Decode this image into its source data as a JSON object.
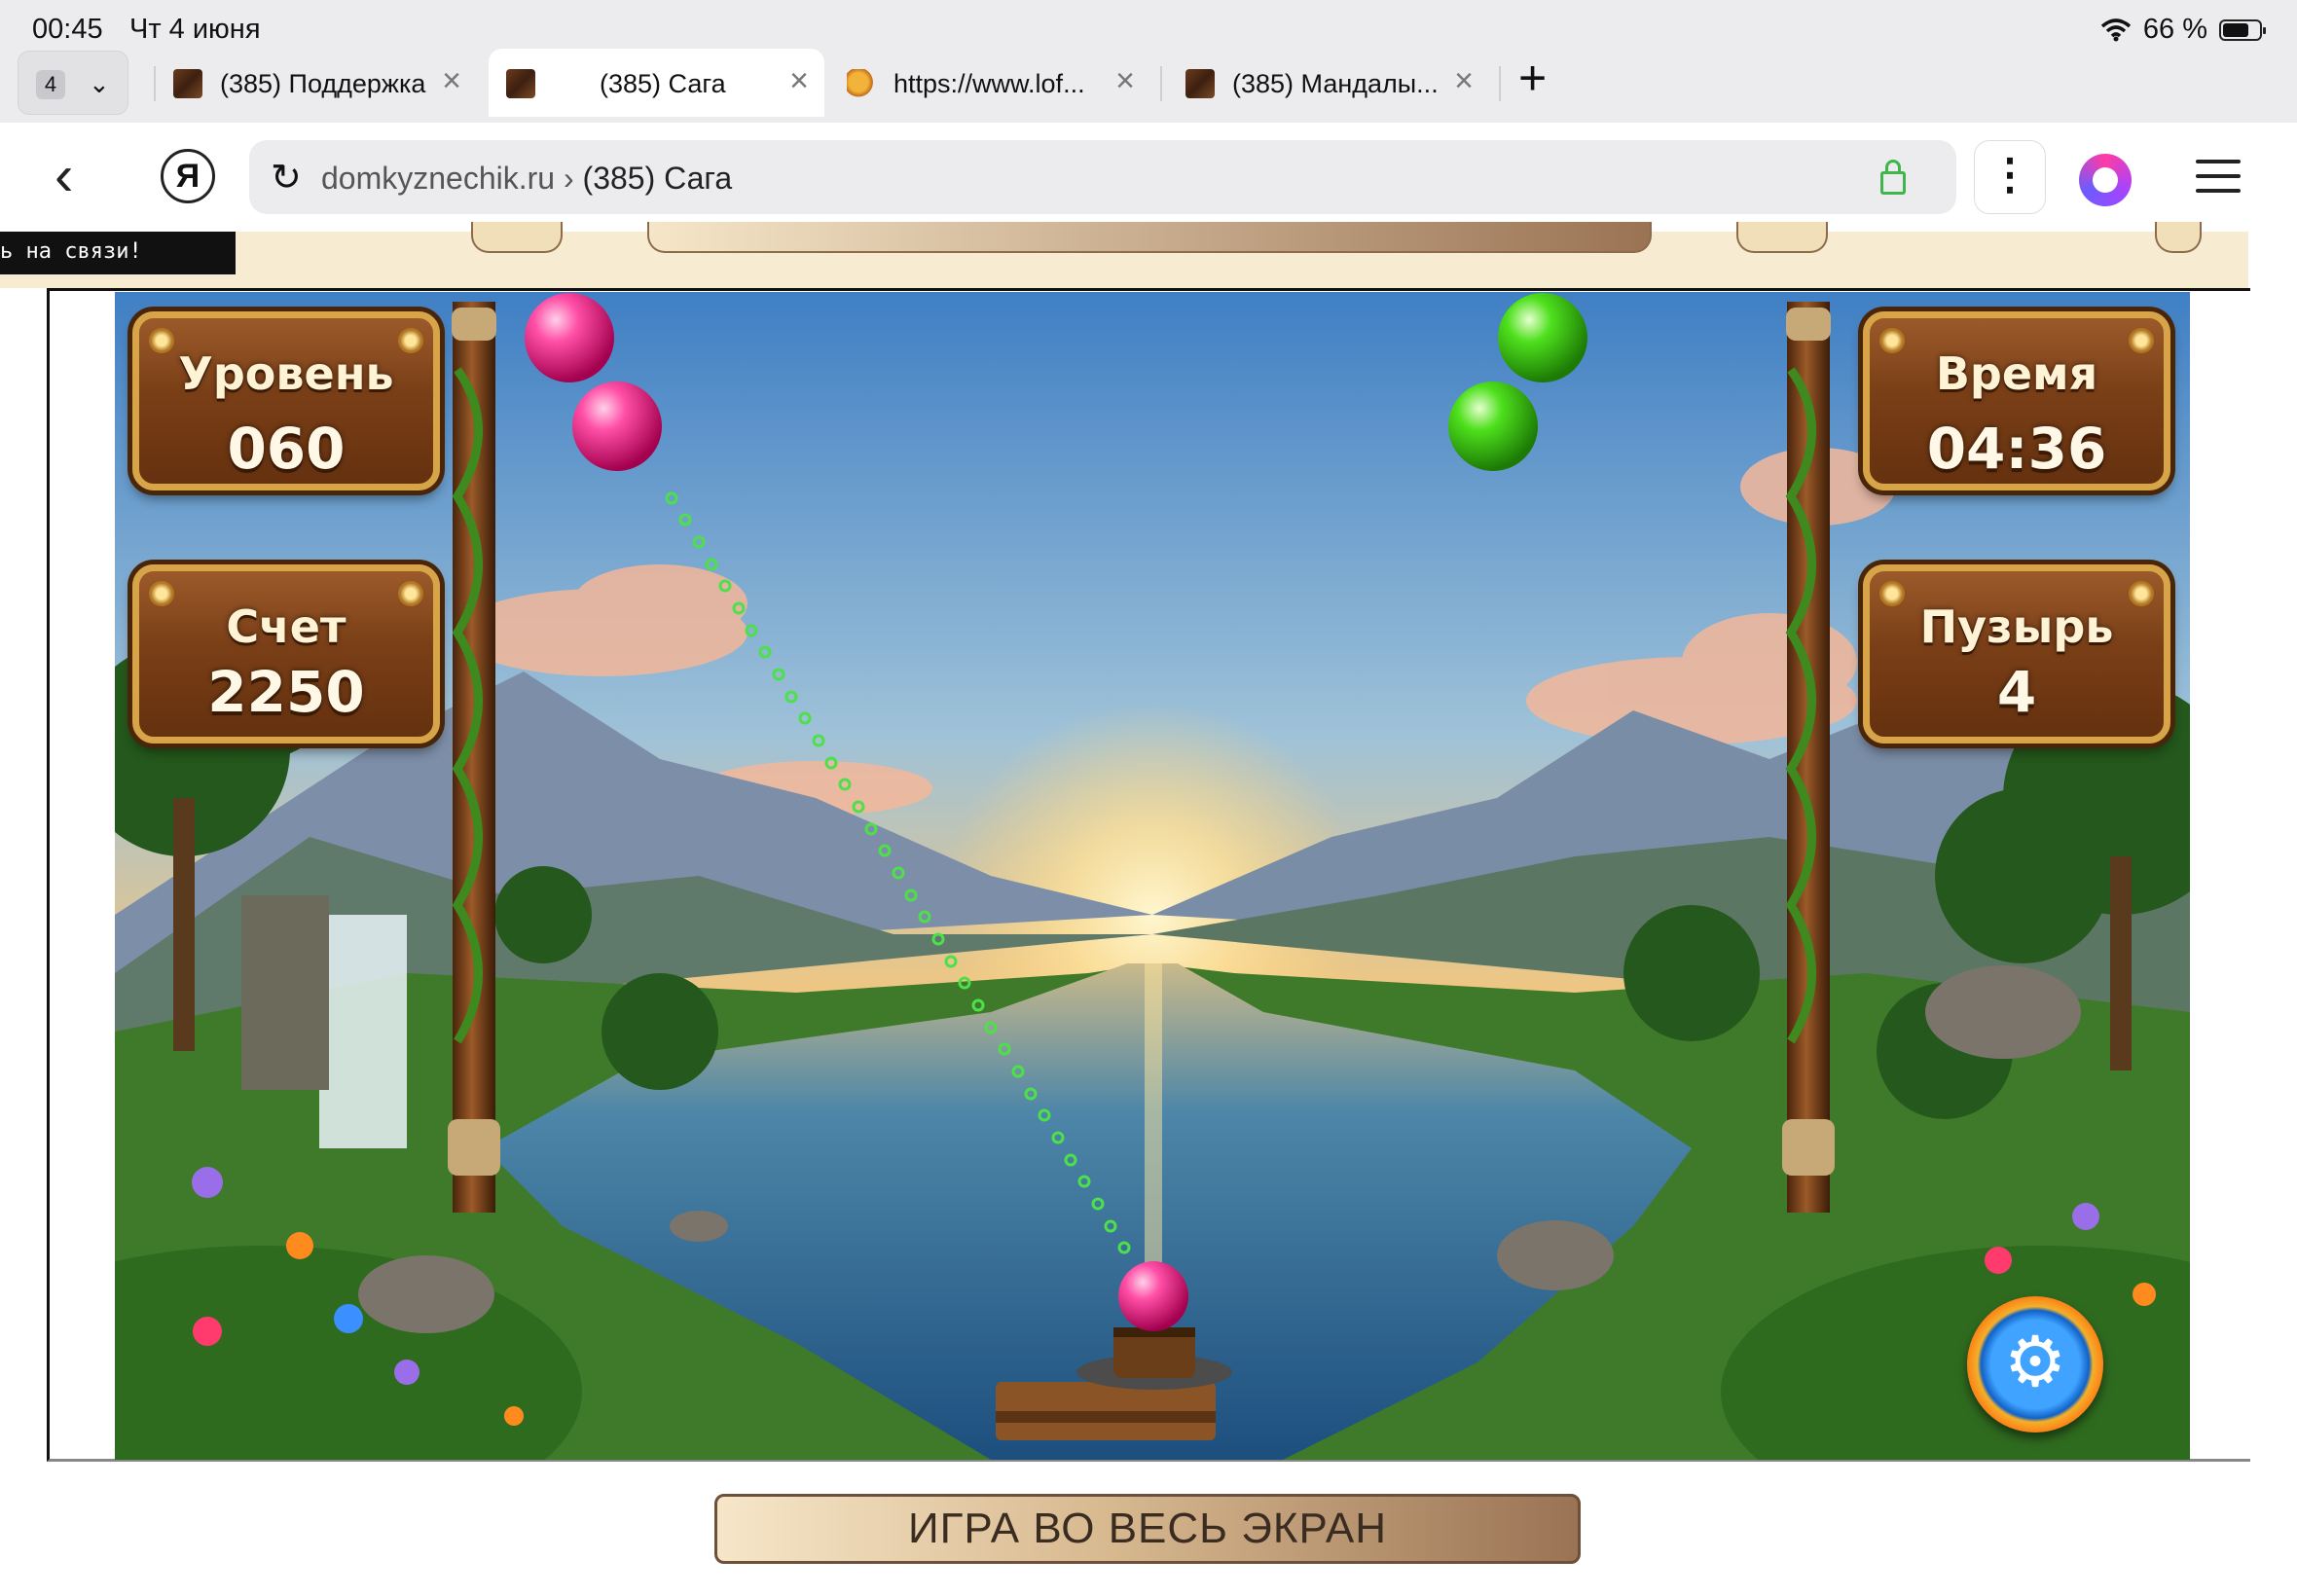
{
  "status_bar": {
    "time": "00:45",
    "date": "Чт 4 июня",
    "battery": "66 %",
    "battery_level": 0.66
  },
  "tab_strip": {
    "tab_count": "4",
    "tabs": [
      {
        "title": "(385) Поддержка",
        "icon": "site-favicon",
        "active": false
      },
      {
        "title": "(385) Сага",
        "icon": "site-favicon",
        "active": true
      },
      {
        "title": "https://www.lof...",
        "icon": "tiger-favicon",
        "active": false
      },
      {
        "title": "(385) Мандалы...",
        "icon": "site-favicon",
        "active": false
      }
    ]
  },
  "address_bar": {
    "domain": "domkyznechik.ru",
    "separator": "›",
    "page_title": "(385) Сага",
    "secure": true
  },
  "chat_tip": {
    "text": "ь на связи!"
  },
  "game": {
    "level": {
      "label": "Уровень",
      "value": "060"
    },
    "time": {
      "label": "Время",
      "value": "04:36"
    },
    "score": {
      "label": "Счет",
      "value": "2250"
    },
    "bubbles": {
      "label": "Пузырь",
      "value": "4"
    },
    "colors": {
      "pink": "#ff2f8f",
      "green": "#35d11a",
      "aim": "#4ee04a"
    }
  },
  "fullscreen_button": {
    "label": "ИГРА ВО ВЕСЬ ЭКРАН"
  }
}
